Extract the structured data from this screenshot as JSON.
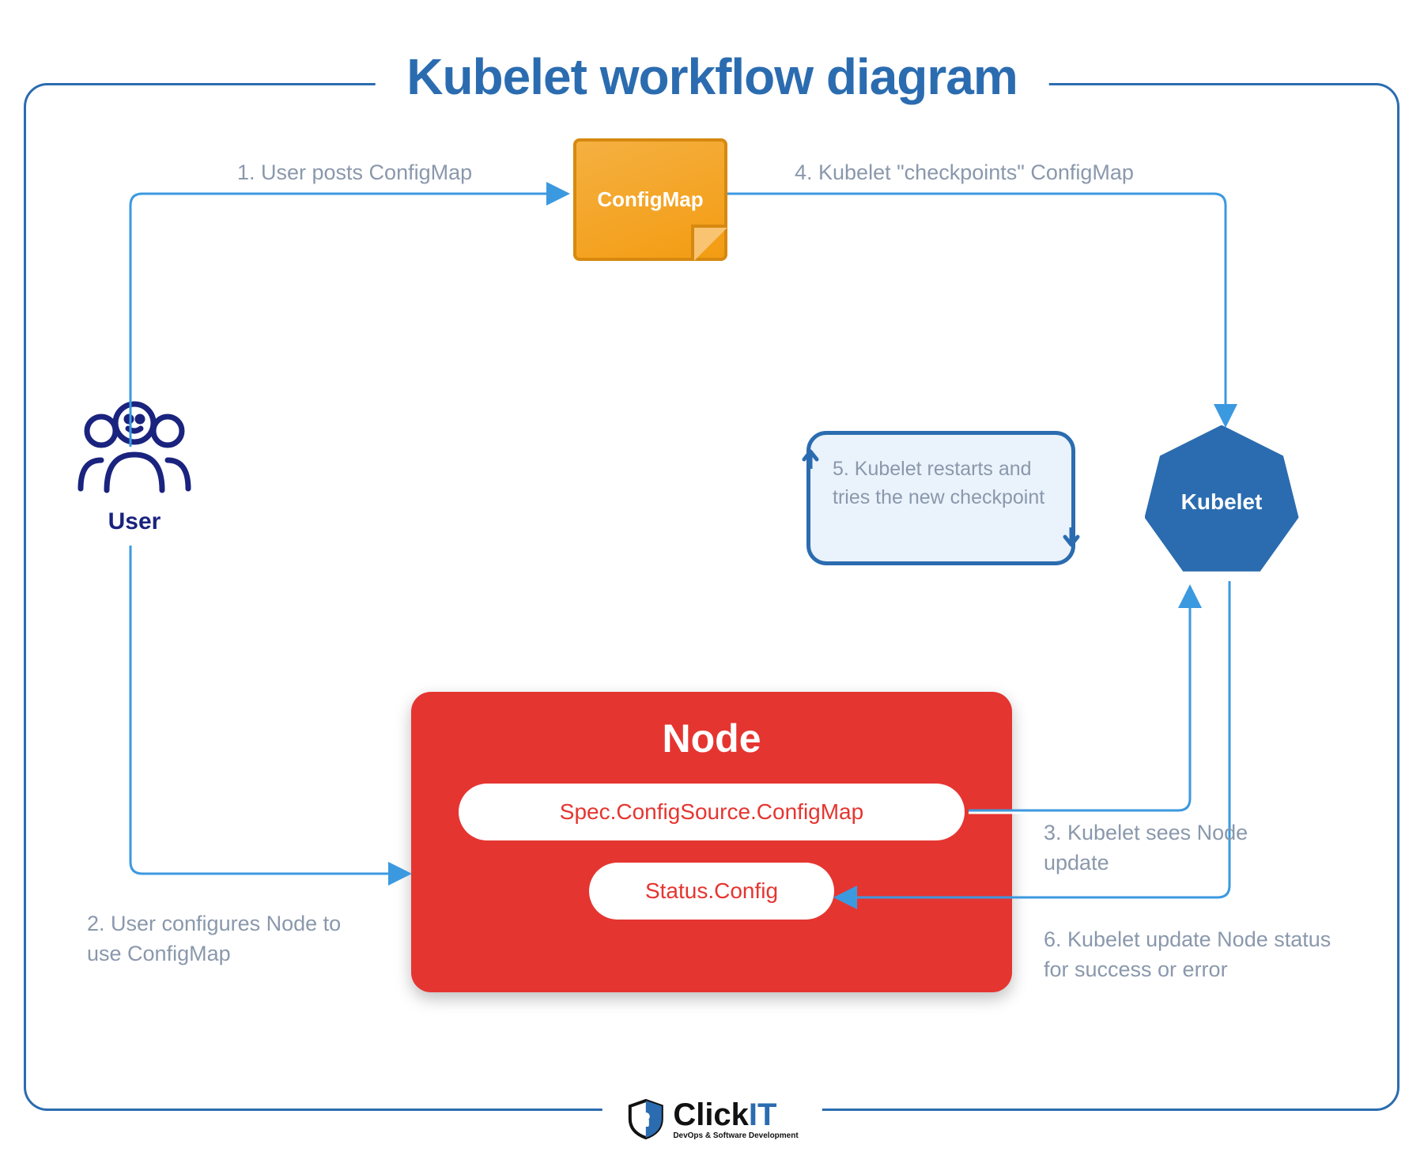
{
  "title": "Kubelet workflow diagram",
  "nodes": {
    "user": "User",
    "configmap": "ConfigMap",
    "kubelet": "Kubelet",
    "node_title": "Node",
    "node_pill1": "Spec.ConfigSource.ConfigMap",
    "node_pill2": "Status.Config"
  },
  "restart_text": "5. Kubelet restarts and tries the new checkpoint",
  "steps": {
    "s1": "1. User posts ConfigMap",
    "s2": "2. User configures Node to use ConfigMap",
    "s3": "3. Kubelet sees Node update",
    "s4": "4. Kubelet \"checkpoints\" ConfigMap",
    "s5": "5. Kubelet restarts and tries the new checkpoint",
    "s6": "6. Kubelet update Node status for success or error"
  },
  "logo": {
    "brand_a": "Click",
    "brand_b": "IT",
    "tagline": "DevOps & Software Development"
  }
}
